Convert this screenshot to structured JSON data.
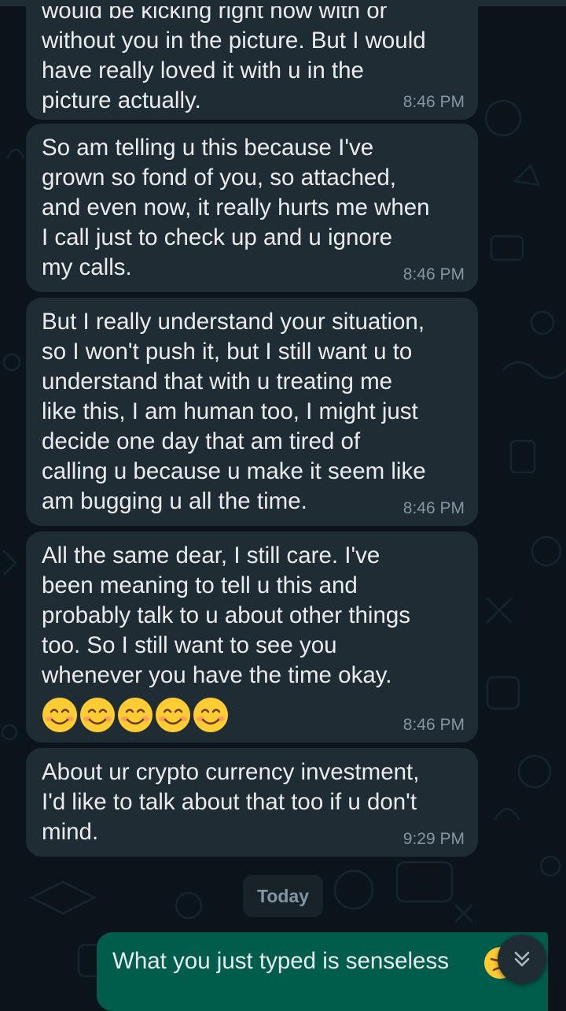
{
  "messages": [
    {
      "text": "would be kicking right now with or\nwithout you in the picture. But I would\nhave really loved it with u in the\npicture actually.",
      "time": "8:46 PM"
    },
    {
      "text": "So am telling u this because I've\ngrown so fond of you, so attached,\nand even now, it really hurts me when\nI call just to check up and u ignore\nmy calls.",
      "time": "8:46 PM"
    },
    {
      "text": "But I really understand your situation,\nso I won't push it, but I still want u to\nunderstand that with u treating me\nlike this, I am human too, I might just\ndecide one day that am tired of\ncalling u because u make it seem like\nam bugging u all the time.",
      "time": "8:46 PM"
    },
    {
      "text": "All the same dear, I still care. I've\nbeen meaning to tell u this and\nprobably talk to u about other things\ntoo. So I still want to see you\nwhenever you have the time okay.",
      "emoji": [
        "smiling-face-emoji",
        "smiling-face-emoji",
        "smiling-face-emoji",
        "smiling-face-emoji",
        "smiling-face-emoji"
      ],
      "time": "8:46 PM"
    },
    {
      "text": "About ur crypto currency investment,\nI'd like to talk about that too if u don't\nmind.",
      "time": "9:29 PM"
    }
  ],
  "date_chip": "Today",
  "outgoing": {
    "text": "What you just typed is senseless"
  },
  "icons": {
    "scroll_down": "double-chevron-down-icon"
  },
  "colors": {
    "background": "#0b141a",
    "incoming_bubble": "#202c33",
    "outgoing_bubble": "#005c4b",
    "text": "#e9edef",
    "meta": "#8696a0"
  }
}
